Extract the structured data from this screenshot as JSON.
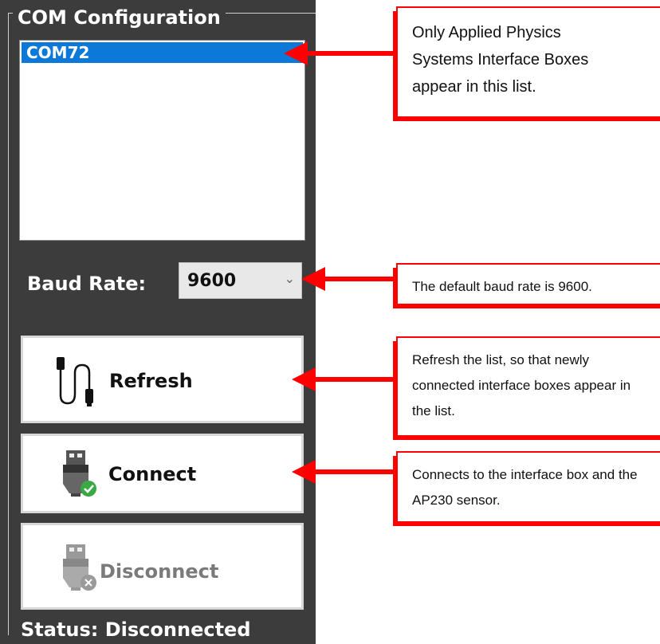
{
  "com_config": {
    "group_title": "COM Configuration",
    "ports": [
      "COM72"
    ],
    "selected_port": "COM72",
    "baud_label": "Baud Rate:",
    "baud_value": "9600",
    "refresh_label": "Refresh",
    "connect_label": "Connect",
    "disconnect_label": "Disconnect",
    "status": "Status: Disconnected"
  },
  "callouts": {
    "list": "Only Applied Physics Systems Interface Boxes appear in this list.",
    "baud": "The default baud rate is 9600.",
    "refresh": "Refresh the list, so that newly connected interface boxes appear in the list.",
    "connect": "Connects to the interface box and the AP230 sensor."
  },
  "colors": {
    "panel": "#3c3c3c",
    "selection": "#0c78d8",
    "callout_border": "#ff0000",
    "arrow": "#ff0000"
  },
  "icons": {
    "refresh": "usb-cable-icon",
    "connect": "usb-connected-icon",
    "disconnect": "usb-disconnected-icon",
    "baud_dropdown": "chevron-down-icon"
  }
}
